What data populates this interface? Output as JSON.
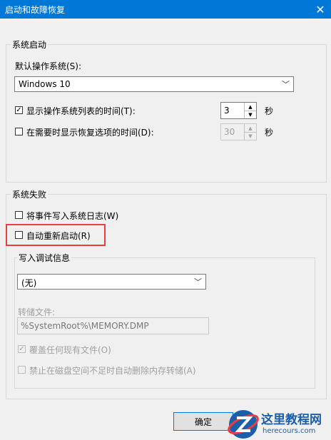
{
  "window": {
    "title": "启动和故障恢复"
  },
  "system_startup": {
    "legend": "系统启动",
    "default_os_label": "默认操作系统(S):",
    "default_os_value": "Windows 10",
    "show_os_list": {
      "label": "显示操作系统列表的时间(T):",
      "checked": true,
      "value": "3",
      "unit": "秒"
    },
    "show_recovery": {
      "label": "在需要时显示恢复选项的时间(D):",
      "checked": false,
      "value": "30",
      "unit": "秒"
    }
  },
  "system_failure": {
    "legend": "系统失败",
    "write_event": {
      "label": "将事件写入系统日志(W)",
      "checked": false
    },
    "auto_restart": {
      "label": "自动重新启动(R)",
      "checked": false
    },
    "debug_info": {
      "legend": "写入调试信息",
      "select_value": "(无)",
      "dump_file_label": "转储文件:",
      "dump_file_value": "%SystemRoot%\\MEMORY.DMP",
      "overwrite": {
        "label": "覆盖任何现有文件(O)",
        "checked": true
      },
      "disable_auto_delete": {
        "label": "禁止在磁盘空间不足时自动删除内存转储(A)",
        "checked": false
      }
    }
  },
  "buttons": {
    "ok": "确定"
  },
  "watermark": {
    "name": "这里教程网",
    "url": "herecours.com"
  },
  "colors": {
    "titlebar": "#0078d7",
    "highlight": "#e83e3e"
  }
}
